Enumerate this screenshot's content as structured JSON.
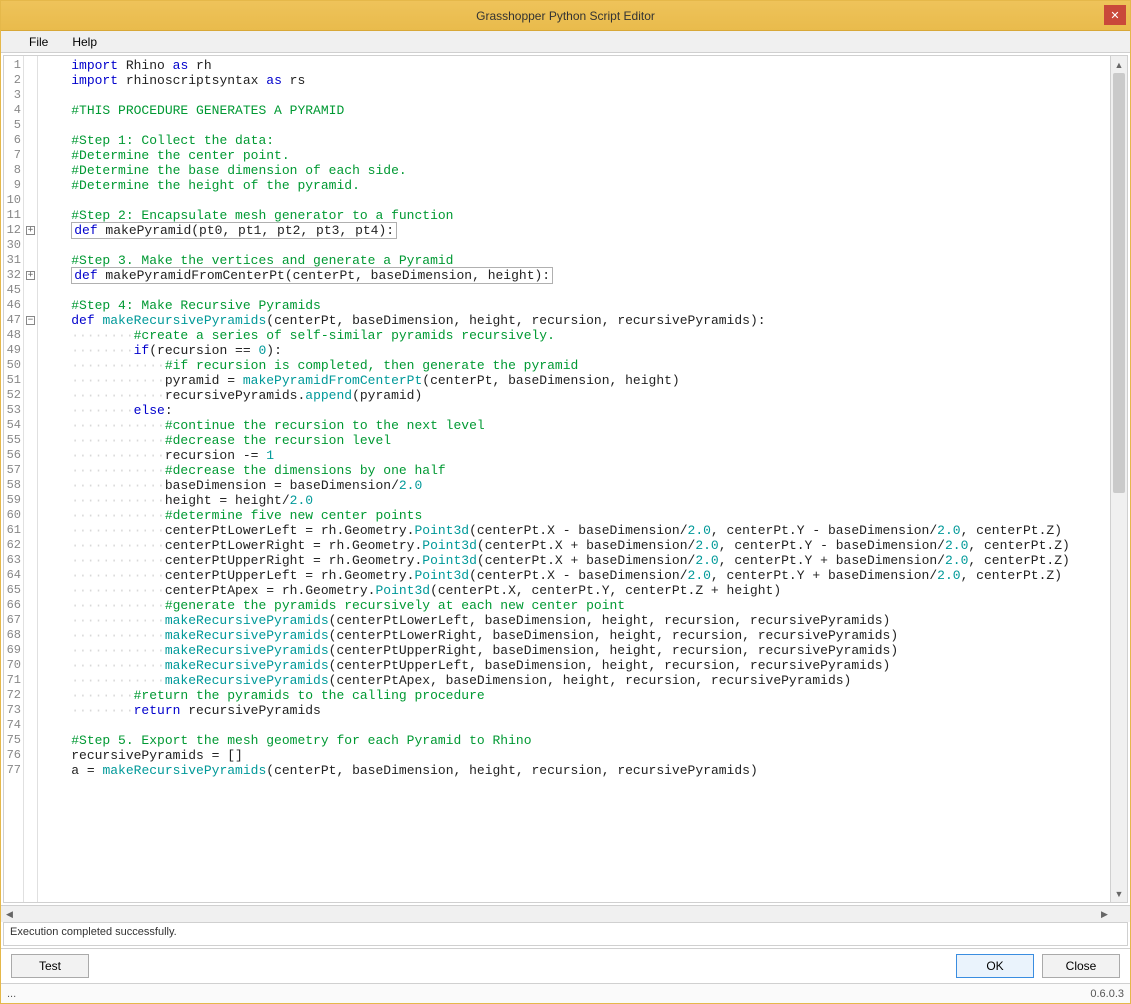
{
  "window": {
    "title": "Grasshopper Python Script Editor",
    "close_label": "✕"
  },
  "menu": {
    "file": "File",
    "help": "Help"
  },
  "editor": {
    "line_numbers": [
      "1",
      "2",
      "3",
      "4",
      "5",
      "6",
      "7",
      "8",
      "9",
      "10",
      "11",
      "12",
      "30",
      "31",
      "32",
      "45",
      "46",
      "47",
      "48",
      "49",
      "50",
      "51",
      "52",
      "53",
      "54",
      "55",
      "56",
      "57",
      "58",
      "59",
      "60",
      "61",
      "62",
      "63",
      "64",
      "65",
      "66",
      "67",
      "68",
      "69",
      "70",
      "71",
      "72",
      "73",
      "74",
      "75",
      "76",
      "77"
    ],
    "fold_plus": "+",
    "fold_minus": "−",
    "lines": {
      "l1": {
        "pre": "    ",
        "a": "import",
        "b": " Rhino ",
        "c": "as",
        "d": " rh"
      },
      "l2": {
        "pre": "    ",
        "a": "import",
        "b": " rhinoscriptsyntax ",
        "c": "as",
        "d": " rs"
      },
      "l4": {
        "pre": "    ",
        "c": "#THIS PROCEDURE GENERATES A PYRAMID"
      },
      "l6": {
        "pre": "    ",
        "c": "#Step 1: Collect the data:"
      },
      "l7": {
        "pre": "    ",
        "c": "#Determine the center point."
      },
      "l8": {
        "pre": "    ",
        "c": "#Determine the base dimension of each side."
      },
      "l9": {
        "pre": "    ",
        "c": "#Determine the height of the pyramid."
      },
      "l11": {
        "pre": "    ",
        "c": "#Step 2: Encapsulate mesh generator to a function"
      },
      "l12": {
        "pre": "    ",
        "fold": "def makePyramid(pt0, pt1, pt2, pt3, pt4):"
      },
      "l31": {
        "pre": "    ",
        "c": "#Step 3. Make the vertices and generate a Pyramid"
      },
      "l32": {
        "pre": "    ",
        "fold": "def makePyramidFromCenterPt(centerPt, baseDimension, height):"
      },
      "l46": {
        "pre": "    ",
        "c": "#Step 4: Make Recursive Pyramids"
      },
      "l47": {
        "pre": "    ",
        "a": "def",
        "b": " ",
        "f": "makeRecursivePyramids",
        "r": "(centerPt, baseDimension, height, recursion, recursivePyramids):"
      },
      "l48": {
        "ws": "········",
        "c": "#create a series of self-similar pyramids recursively."
      },
      "l49": {
        "ws": "········",
        "a": "if",
        "r": "(recursion == ",
        "n": "0",
        "r2": "):"
      },
      "l50": {
        "ws": "············",
        "c": "#if recursion is completed, then generate the pyramid"
      },
      "l51": {
        "ws": "············",
        "t": "pyramid = ",
        "f": "makePyramidFromCenterPt",
        "r": "(centerPt, baseDimension, height)"
      },
      "l52": {
        "ws": "············",
        "t": "recursivePyramids.",
        "f": "append",
        "r": "(pyramid)"
      },
      "l53": {
        "ws": "········",
        "a": "else",
        "r": ":"
      },
      "l54": {
        "ws": "············",
        "c": "#continue the recursion to the next level"
      },
      "l55": {
        "ws": "············",
        "c": "#decrease the recursion level"
      },
      "l56": {
        "ws": "············",
        "t": "recursion -= ",
        "n": "1"
      },
      "l57": {
        "ws": "············",
        "c": "#decrease the dimensions by one half"
      },
      "l58": {
        "ws": "············",
        "t": "baseDimension = baseDimension/",
        "n": "2.0"
      },
      "l59": {
        "ws": "············",
        "t": "height = height/",
        "n": "2.0"
      },
      "l60": {
        "ws": "············",
        "c": "#determine five new center points"
      },
      "l61": {
        "ws": "············",
        "t": "centerPtLowerLeft = rh.Geometry.",
        "f": "Point3d",
        "r": "(centerPt.X - baseDimension/",
        "n": "2.0",
        "r2": ", centerPt.Y - baseDimension/",
        "n2": "2.0",
        "r3": ", centerPt.Z)"
      },
      "l62": {
        "ws": "············",
        "t": "centerPtLowerRight = rh.Geometry.",
        "f": "Point3d",
        "r": "(centerPt.X + baseDimension/",
        "n": "2.0",
        "r2": ", centerPt.Y - baseDimension/",
        "n2": "2.0",
        "r3": ", centerPt.Z)"
      },
      "l63": {
        "ws": "············",
        "t": "centerPtUpperRight = rh.Geometry.",
        "f": "Point3d",
        "r": "(centerPt.X + baseDimension/",
        "n": "2.0",
        "r2": ", centerPt.Y + baseDimension/",
        "n2": "2.0",
        "r3": ", centerPt.Z)"
      },
      "l64": {
        "ws": "············",
        "t": "centerPtUpperLeft = rh.Geometry.",
        "f": "Point3d",
        "r": "(centerPt.X - baseDimension/",
        "n": "2.0",
        "r2": ", centerPt.Y + baseDimension/",
        "n2": "2.0",
        "r3": ", centerPt.Z)"
      },
      "l65": {
        "ws": "············",
        "t": "centerPtApex = rh.Geometry.",
        "f": "Point3d",
        "r": "(centerPt.X, centerPt.Y, centerPt.Z + height)"
      },
      "l66": {
        "ws": "············",
        "c": "#generate the pyramids recursively at each new center point"
      },
      "l67": {
        "ws": "············",
        "f": "makeRecursivePyramids",
        "r": "(centerPtLowerLeft, baseDimension, height, recursion, recursivePyramids)"
      },
      "l68": {
        "ws": "············",
        "f": "makeRecursivePyramids",
        "r": "(centerPtLowerRight, baseDimension, height, recursion, recursivePyramids)"
      },
      "l69": {
        "ws": "············",
        "f": "makeRecursivePyramids",
        "r": "(centerPtUpperRight, baseDimension, height, recursion, recursivePyramids)"
      },
      "l70": {
        "ws": "············",
        "f": "makeRecursivePyramids",
        "r": "(centerPtUpperLeft, baseDimension, height, recursion, recursivePyramids)"
      },
      "l71": {
        "ws": "············",
        "f": "makeRecursivePyramids",
        "r": "(centerPtApex, baseDimension, height, recursion, recursivePyramids)"
      },
      "l72": {
        "ws": "········",
        "c": "#return the pyramids to the calling procedure"
      },
      "l73": {
        "ws": "········",
        "a": "return",
        "b": " recursivePyramids"
      },
      "l75": {
        "pre": "    ",
        "c": "#Step 5. Export the mesh geometry for each Pyramid to Rhino"
      },
      "l76": {
        "pre": "    ",
        "t": "recursivePyramids = []"
      },
      "l77": {
        "pre": "    ",
        "t": "a = ",
        "f": "makeRecursivePyramids",
        "r": "(centerPt, baseDimension, height, recursion, recursivePyramids)"
      }
    }
  },
  "output": {
    "message": "Execution completed successfully."
  },
  "buttons": {
    "test": "Test",
    "ok": "OK",
    "close": "Close"
  },
  "status": {
    "left": "...",
    "version": "0.6.0.3"
  }
}
